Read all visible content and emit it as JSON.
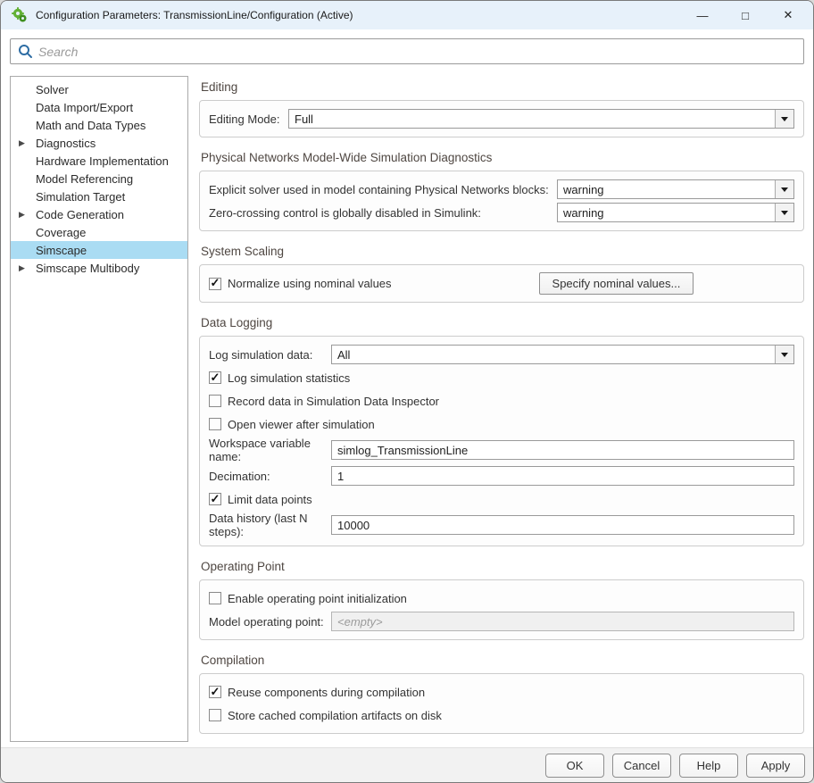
{
  "window": {
    "title": "Configuration Parameters: TransmissionLine/Configuration (Active)",
    "controls": {
      "minimize": "—",
      "maximize": "□",
      "close": "✕"
    }
  },
  "search": {
    "placeholder": "Search"
  },
  "sidebar": {
    "items": [
      {
        "label": "Solver",
        "expandable": false,
        "selected": false
      },
      {
        "label": "Data Import/Export",
        "expandable": false,
        "selected": false
      },
      {
        "label": "Math and Data Types",
        "expandable": false,
        "selected": false
      },
      {
        "label": "Diagnostics",
        "expandable": true,
        "selected": false
      },
      {
        "label": "Hardware Implementation",
        "expandable": false,
        "selected": false
      },
      {
        "label": "Model Referencing",
        "expandable": false,
        "selected": false
      },
      {
        "label": "Simulation Target",
        "expandable": false,
        "selected": false
      },
      {
        "label": "Code Generation",
        "expandable": true,
        "selected": false
      },
      {
        "label": "Coverage",
        "expandable": false,
        "selected": false
      },
      {
        "label": "Simscape",
        "expandable": false,
        "selected": true
      },
      {
        "label": "Simscape Multibody",
        "expandable": true,
        "selected": false
      }
    ]
  },
  "sections": {
    "editing": {
      "title": "Editing",
      "editing_mode_label": "Editing Mode:",
      "editing_mode_value": "Full"
    },
    "diagnostics": {
      "title": "Physical Networks Model-Wide Simulation Diagnostics",
      "explicit_solver_label": "Explicit solver used in model containing Physical Networks blocks:",
      "explicit_solver_value": "warning",
      "zero_crossing_label": "Zero-crossing control is globally disabled in Simulink:",
      "zero_crossing_value": "warning"
    },
    "system_scaling": {
      "title": "System Scaling",
      "normalize_label": "Normalize using nominal values",
      "normalize_checked": true,
      "specify_button_label": "Specify nominal values..."
    },
    "data_logging": {
      "title": "Data Logging",
      "log_data_label": "Log simulation data:",
      "log_data_value": "All",
      "log_stats_label": "Log simulation statistics",
      "log_stats_checked": true,
      "record_sdi_label": "Record data in Simulation Data Inspector",
      "record_sdi_checked": false,
      "open_viewer_label": "Open viewer after simulation",
      "open_viewer_checked": false,
      "workspace_var_label": "Workspace variable name:",
      "workspace_var_value": "simlog_TransmissionLine",
      "decimation_label": "Decimation:",
      "decimation_value": "1",
      "limit_points_label": "Limit data points",
      "limit_points_checked": true,
      "data_history_label": "Data history (last N steps):",
      "data_history_value": "10000"
    },
    "operating_point": {
      "title": "Operating Point",
      "enable_label": "Enable operating point initialization",
      "enable_checked": false,
      "model_op_label": "Model operating point:",
      "model_op_value": "<empty>"
    },
    "compilation": {
      "title": "Compilation",
      "reuse_label": "Reuse components during compilation",
      "reuse_checked": true,
      "store_label": "Store cached compilation artifacts on disk",
      "store_checked": false
    },
    "more_indicator": "..."
  },
  "footer": {
    "ok_label": "OK",
    "cancel_label": "Cancel",
    "help_label": "Help",
    "apply_label": "Apply"
  },
  "colors": {
    "titlebar_bg": "#e7f1fa",
    "selection_bg": "#aadcf3",
    "search_icon_blue": "#2e6da4",
    "heading_text": "#4f4742",
    "app_icon_green": "#63b135"
  },
  "icons": {
    "app": "simulink-gears",
    "search": "magnifier",
    "dropdown": "caret-down",
    "tree_expand": "right-triangle"
  }
}
